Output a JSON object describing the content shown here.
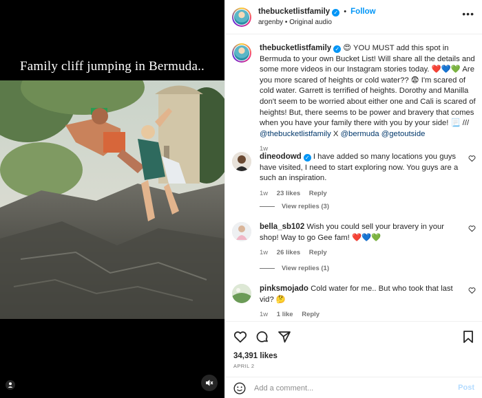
{
  "media": {
    "overlay_text": "Family cliff jumping in Bermuda.."
  },
  "header": {
    "username": "thebucketlistfamily",
    "follow_label": "Follow",
    "subline": "argenby • Original audio"
  },
  "caption": {
    "username": "thebucketlistfamily",
    "text_1": " 😍 YOU MUST add this spot in Bermuda to your own Bucket List! Will share all the details and some more videos in our Instagram stories today. ❤️💙💚 Are you more scared of heights or cold water?? 😨 I'm scared of cold water. Garrett is terrified of heights. Dorothy and Manilla don't seem to be worried about either one and Cali is scared of heights! But, there seems to be power and bravery that comes when you have your family there with you by your side! 📃 /// ",
    "mention_1": "@thebucketlistfamily",
    "text_2": " X ",
    "mention_2": "@bermuda",
    "mention_3": "@getoutside",
    "time": "1w"
  },
  "comments": [
    {
      "username": "dineodowd",
      "verified": true,
      "text": "I have added so many locations you guys have visited, I need to start exploring now. You guys are a such an inspiration.",
      "time": "1w",
      "likes": "23 likes",
      "reply": "Reply",
      "view_replies": "View replies (3)"
    },
    {
      "username": "bella_sb102",
      "text": "Wish you could sell your bravery in your shop! Way to go Gee fam! ❤️💙💚",
      "time": "1w",
      "likes": "26 likes",
      "reply": "Reply",
      "view_replies": "View replies (1)"
    },
    {
      "username": "pinksmojado",
      "text": "Cold water for me.. But who took that last vid? 🤔",
      "time": "1w",
      "likes": "1 like",
      "reply": "Reply"
    }
  ],
  "footer": {
    "likes": "34,391 likes",
    "date": "APRIL 2",
    "comment_placeholder": "Add a comment...",
    "post_label": "Post"
  },
  "colors": {
    "accent": "#0095f6",
    "post_disabled": "#b3dbff"
  }
}
